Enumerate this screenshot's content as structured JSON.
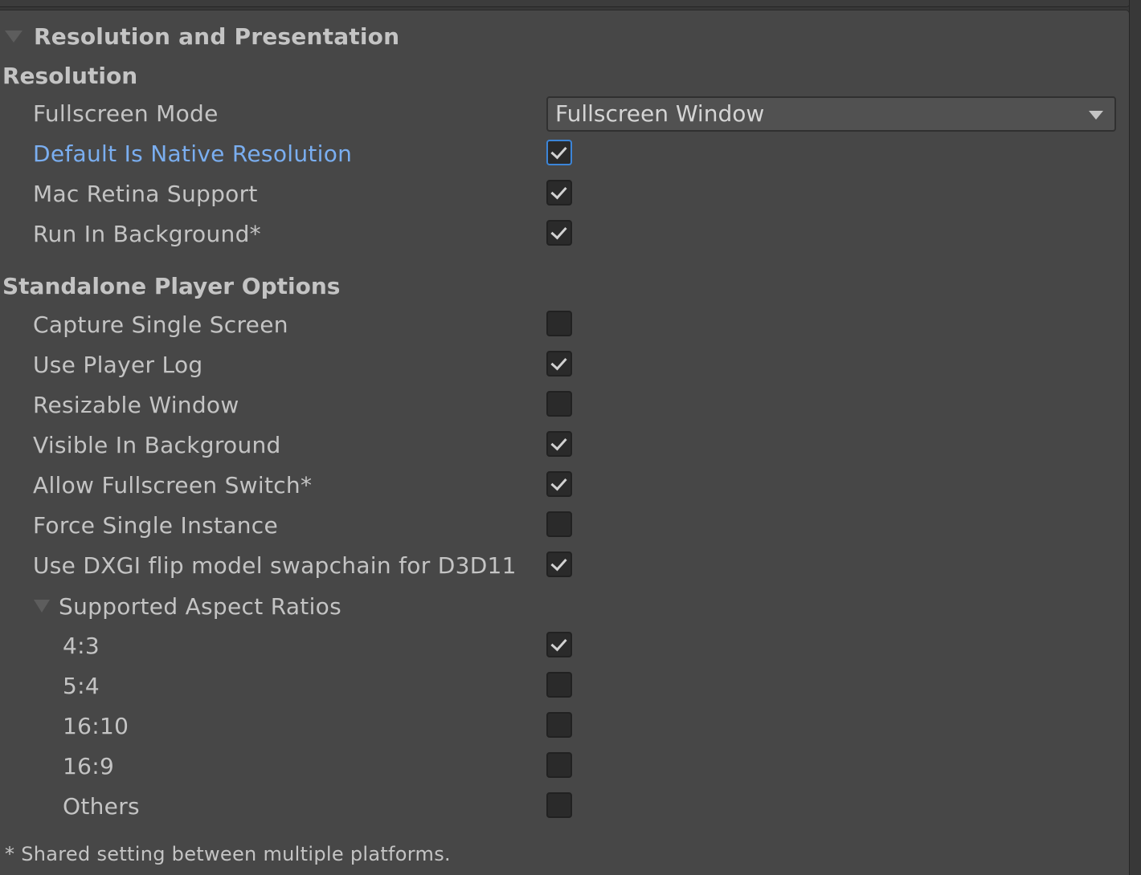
{
  "section": {
    "title": "Resolution and Presentation"
  },
  "resolution": {
    "heading": "Resolution",
    "fullscreen_mode": {
      "label": "Fullscreen Mode",
      "value": "Fullscreen Window"
    },
    "toggles": [
      {
        "label": "Default Is Native Resolution",
        "checked": true
      },
      {
        "label": "Mac Retina Support",
        "checked": true
      },
      {
        "label": "Run In Background*",
        "checked": true
      }
    ]
  },
  "standalone": {
    "heading": "Standalone Player Options",
    "toggles": [
      {
        "label": "Capture Single Screen",
        "checked": false
      },
      {
        "label": "Use Player Log",
        "checked": true
      },
      {
        "label": "Resizable Window",
        "checked": false
      },
      {
        "label": "Visible In Background",
        "checked": true
      },
      {
        "label": "Allow Fullscreen Switch*",
        "checked": true
      },
      {
        "label": "Force Single Instance",
        "checked": false
      },
      {
        "label": "Use DXGI flip model swapchain for D3D11",
        "checked": true
      }
    ]
  },
  "aspect_ratios": {
    "title": "Supported Aspect Ratios",
    "items": [
      {
        "label": "4:3",
        "checked": true
      },
      {
        "label": "5:4",
        "checked": false
      },
      {
        "label": "16:10",
        "checked": false
      },
      {
        "label": "16:9",
        "checked": false
      },
      {
        "label": "Others",
        "checked": false
      }
    ]
  },
  "footnote": "* Shared setting between multiple platforms.",
  "colors": {
    "panel_bg": "#474747",
    "text": "#c4c4c4",
    "highlight_text": "#7aaef0",
    "focus_border": "#3c85d8",
    "checkbox_bg": "#2a2a2a"
  }
}
